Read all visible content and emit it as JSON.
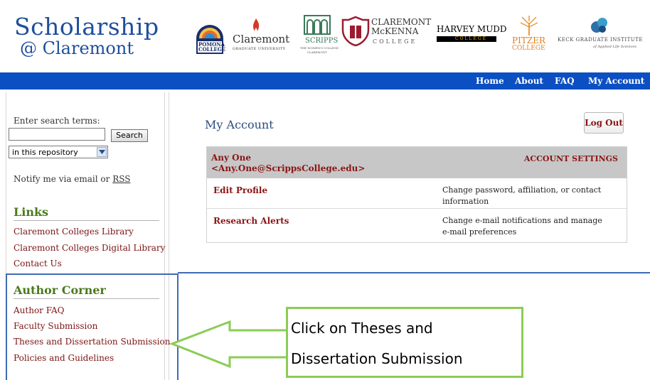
{
  "header": {
    "site_title_line1": "Scholarship",
    "site_title_line2": "@ Claremont",
    "logos": [
      {
        "name": "pomona-college",
        "text_lines": [
          "POMONA",
          "COLLEGE"
        ]
      },
      {
        "name": "claremont-graduate-university",
        "text_lines": [
          "Claremont",
          "GRADUATE UNIVERSITY"
        ]
      },
      {
        "name": "scripps-college",
        "text_lines": [
          "SCRIPPS",
          "THE WOMEN'S COLLEGE",
          "CLAREMONT"
        ]
      },
      {
        "name": "claremont-mckenna-college",
        "text_lines": [
          "CLAREMONT",
          "McKENNA",
          "COLLEGE"
        ]
      },
      {
        "name": "harvey-mudd-college",
        "text_lines": [
          "HARVEY MUDD",
          "COLLEGE"
        ]
      },
      {
        "name": "pitzer-college",
        "text_lines": [
          "PITZER",
          "COLLEGE"
        ]
      },
      {
        "name": "keck-graduate-institute",
        "text_lines": [
          "KECK GRADUATE INSTITUTE",
          "of Applied Life Sciences"
        ]
      }
    ]
  },
  "nav": {
    "items": [
      "Home",
      "About",
      "FAQ",
      "My Account"
    ]
  },
  "sidebar": {
    "search_label": "Enter search terms:",
    "search_value": "",
    "search_button": "Search",
    "scope_value": "in this repository",
    "notify_text": "Notify me via email or ",
    "notify_link": "RSS",
    "links_heading": "Links",
    "links": [
      "Claremont Colleges Library",
      "Claremont Colleges Digital Library",
      "Contact Us"
    ],
    "author_heading": "Author Corner",
    "author_links": [
      "Author FAQ",
      "Faculty Submission",
      "Theses and Dissertation Submission",
      "Policies and Guidelines"
    ]
  },
  "main": {
    "title": "My Account",
    "logout_label": "Log Out",
    "account": {
      "name": "Any One",
      "email": "<Any.One@ScrippsCollege.edu>",
      "settings_label": "ACCOUNT SETTINGS",
      "rows": [
        {
          "label": "Edit Profile",
          "desc_line1": "Change password, affiliation, or contact",
          "desc_line2": "information"
        },
        {
          "label": "Research Alerts",
          "desc_line1": "Change e-mail notifications and manage",
          "desc_line2": "e-mail preferences"
        }
      ]
    }
  },
  "annotation": {
    "line1": "Click on Theses and",
    "line2": "Dissertation Submission"
  },
  "colors": {
    "brand_blue": "#1e4f9c",
    "nav_blue": "#0b4fc2",
    "link_red": "#7a1414",
    "heading_green": "#4a7a1c",
    "callout_green": "#8ccc55",
    "highlight_blue": "#3f6bb5"
  }
}
